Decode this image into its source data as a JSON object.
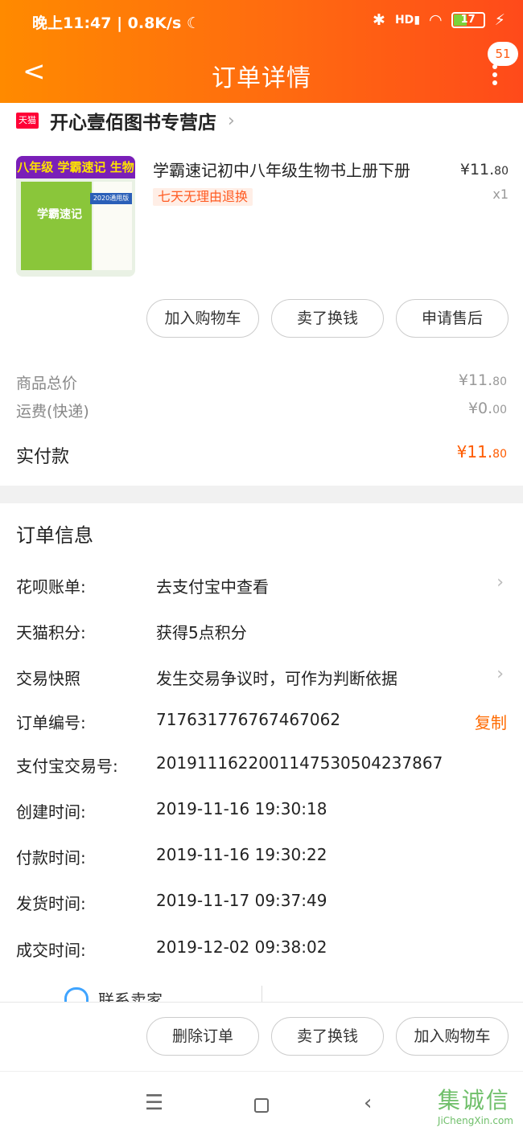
{
  "status_bar": {
    "left_text": "晚上11:47 | 0.8K/s ☾",
    "network": "HD",
    "battery": "17"
  },
  "navbar": {
    "title": "订单详情",
    "badge": "51"
  },
  "shop": {
    "logo_text": "天猫",
    "name": "开心壹佰图书专营店"
  },
  "product": {
    "cover_title": "八年级 学霸速记 生物",
    "cover_edition": "2020通用版",
    "cover_brand": "学霸速记",
    "name": "学霸速记初中八年级生物书上册下册",
    "tag": "七天无理由退换",
    "price_int": "¥11.",
    "price_dec": "80",
    "quantity": "x1"
  },
  "product_buttons": [
    "加入购物车",
    "卖了换钱",
    "申请售后"
  ],
  "costs": {
    "goods_label": "商品总价",
    "goods_int": "¥11.",
    "goods_dec": "80",
    "shipping_label": "运费(快递)",
    "shipping_int": "¥0.",
    "shipping_dec": "00",
    "paid_label": "实付款",
    "paid_int": "¥11.",
    "paid_dec": "80"
  },
  "order_info": {
    "title": "订单信息",
    "rows": [
      {
        "label": "花呗账单:",
        "value": "去支付宝中查看"
      },
      {
        "label": "天猫积分:",
        "value": "获得5点积分"
      },
      {
        "label": "交易快照",
        "value": "发生交易争议时，可作为判断依据"
      },
      {
        "label": "订单编号:",
        "value": "717631776767467062",
        "action": "复制"
      },
      {
        "label": "支付宝交易号:",
        "value": "2019111622001147530504237867"
      },
      {
        "label": "创建时间:",
        "value": "2019-11-16 19:30:18"
      },
      {
        "label": "付款时间:",
        "value": "2019-11-16 19:30:22"
      },
      {
        "label": "发货时间:",
        "value": "2019-11-17 09:37:49"
      },
      {
        "label": "成交时间:",
        "value": "2019-12-02 09:38:02"
      }
    ]
  },
  "contact": {
    "label": "联系卖家"
  },
  "bottom_buttons": [
    "删除订单",
    "卖了换钱",
    "加入购物车"
  ],
  "watermark": {
    "brand": "集诚信",
    "domain": "JiChengXin.com"
  },
  "colors": {
    "header_start": "#ff8a00",
    "header_end": "#ff4a1a",
    "accent": "#ff5b00",
    "tmall_red": "#ff0036"
  }
}
